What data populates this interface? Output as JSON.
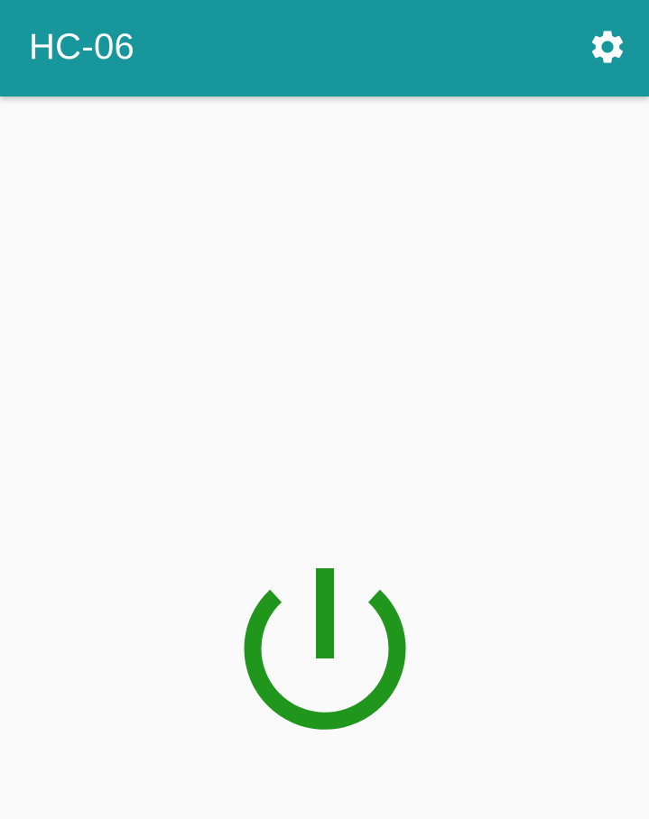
{
  "toolbar": {
    "title": "HC-06",
    "background_color": "#17979b",
    "settings_icon": "gear-icon"
  },
  "main": {
    "power_icon": "power-icon",
    "power_color": "#21961d"
  }
}
